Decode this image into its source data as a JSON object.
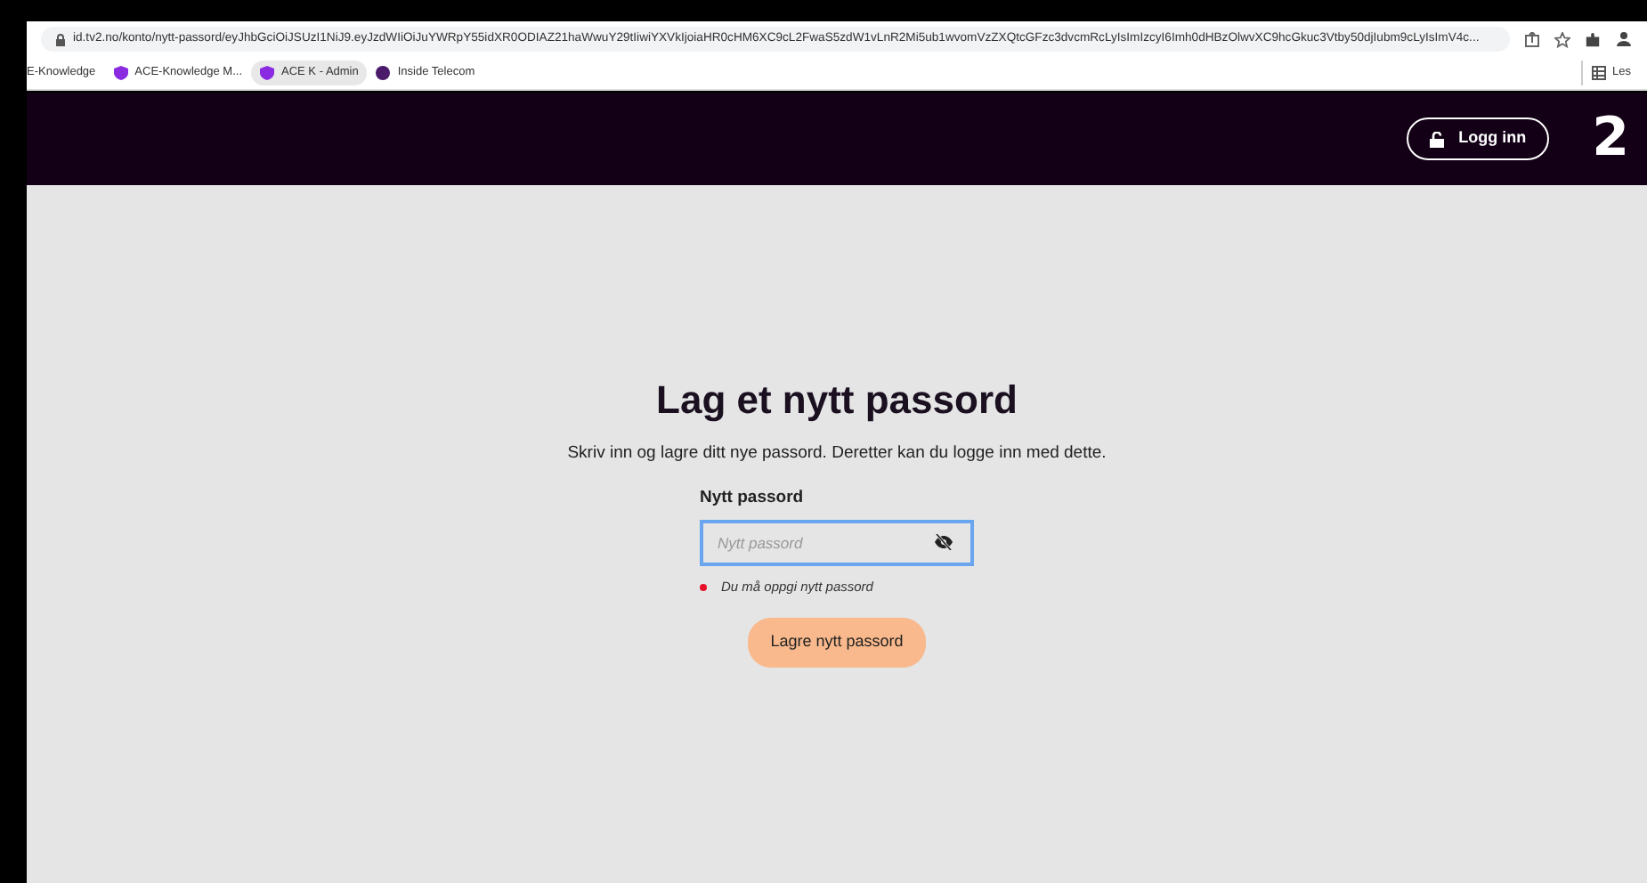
{
  "browser": {
    "url": "id.tv2.no/konto/nytt-passord/eyJhbGciOiJSUzI1NiJ9.eyJzdWIiOiJuYWRpY55idXR0ODIAZ21haWwuY29tIiwiYXVkIjoiaHR0cHM6XC9cL2FwaS5zdW1vLnR2Mi5ub1wvomVzZXQtcGFzc3dvcmRcLyIsImIzcyI6Imh0dHBzOlwvXC9hcGkuc3Vtby50djIubm9cLyIsImV4c...",
    "bookmarks": [
      {
        "label": "E-Knowledge",
        "kind": "plain",
        "selected": false
      },
      {
        "label": "ACE-Knowledge M...",
        "kind": "shield",
        "selected": false
      },
      {
        "label": "ACE K - Admin",
        "kind": "shield",
        "selected": true
      },
      {
        "label": "Inside Telecom",
        "kind": "globe",
        "selected": false
      }
    ],
    "reading_list": "Les"
  },
  "header": {
    "login_button": "Logg inn",
    "logo": "2"
  },
  "form": {
    "title": "Lag et nytt passord",
    "description": "Skriv inn og lagre ditt nye passord. Deretter kan du logge inn med dette.",
    "field_label": "Nytt passord",
    "field": {
      "placeholder": "Nytt passord",
      "focused": true
    },
    "error": "Du må oppgi nytt passord",
    "submit": "Lagre nytt passord"
  }
}
